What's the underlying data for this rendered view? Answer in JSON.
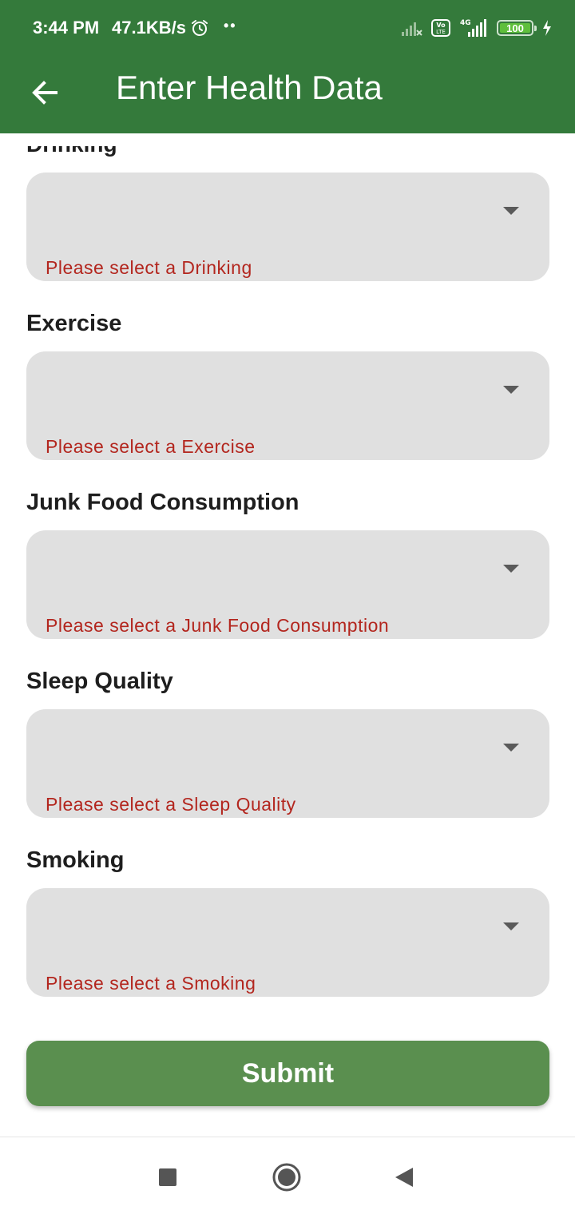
{
  "status_bar": {
    "time": "3:44 PM",
    "net_speed": "47.1KB/s",
    "dots": "••",
    "battery": "100",
    "network_label": "4G",
    "volte_label": "Vo LTE"
  },
  "app_bar": {
    "title": "Enter Health Data",
    "back_icon": "arrow-left-icon"
  },
  "form": {
    "cut_off_label": "Drinking",
    "fields": [
      {
        "label": "Drinking",
        "error": "Please select a Drinking"
      },
      {
        "label": "Exercise",
        "error": "Please select a Exercise"
      },
      {
        "label": "Junk Food Consumption",
        "error": "Please select a Junk Food Consumption"
      },
      {
        "label": "Sleep Quality",
        "error": "Please select a Sleep Quality"
      },
      {
        "label": "Smoking",
        "error": "Please select a Smoking"
      }
    ],
    "submit_label": "Submit"
  },
  "colors": {
    "app_bar": "#347a3b",
    "submit": "#5a8f4f",
    "error": "#b3261e",
    "field_bg": "#e0e0e0"
  },
  "nav_bar": {
    "icons": [
      "recents-square-icon",
      "home-circle-icon",
      "back-triangle-icon"
    ]
  }
}
